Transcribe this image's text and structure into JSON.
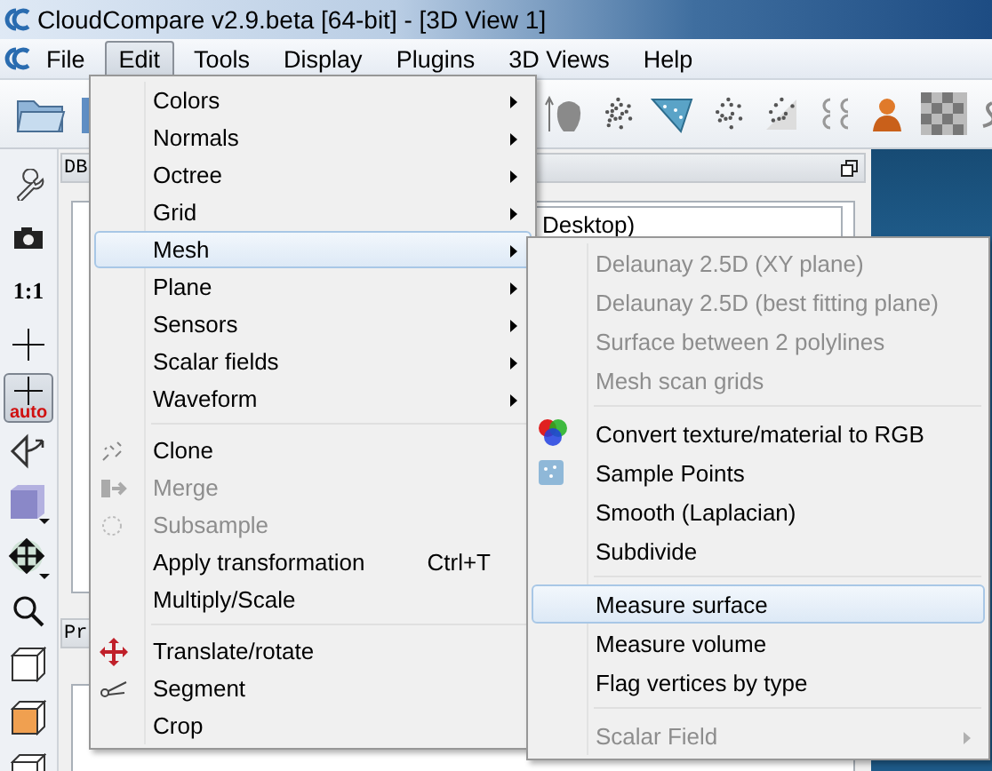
{
  "window": {
    "title": "CloudCompare v2.9.beta [64-bit] - [3D View 1]"
  },
  "menubar": [
    {
      "label": "File",
      "selected": false
    },
    {
      "label": "Edit",
      "selected": true
    },
    {
      "label": "Tools",
      "selected": false
    },
    {
      "label": "Display",
      "selected": false
    },
    {
      "label": "Plugins",
      "selected": false
    },
    {
      "label": "3D Views",
      "selected": false
    },
    {
      "label": "Help",
      "selected": false
    }
  ],
  "left_toolbar": {
    "scale_label": "1:1",
    "auto_label": "auto",
    "auto_pressed": true
  },
  "db_panel": {
    "title": "DB",
    "path": "Desktop)"
  },
  "properties_panel": {
    "title": "Pr"
  },
  "edit_menu": {
    "items": [
      {
        "kind": "submenu",
        "label": "Colors",
        "highlighted": false,
        "disabled": false
      },
      {
        "kind": "submenu",
        "label": "Normals",
        "highlighted": false,
        "disabled": false
      },
      {
        "kind": "submenu",
        "label": "Octree",
        "highlighted": false,
        "disabled": false
      },
      {
        "kind": "submenu",
        "label": "Grid",
        "highlighted": false,
        "disabled": false
      },
      {
        "kind": "submenu",
        "label": "Mesh",
        "highlighted": true,
        "disabled": false
      },
      {
        "kind": "submenu",
        "label": "Plane",
        "highlighted": false,
        "disabled": false
      },
      {
        "kind": "submenu",
        "label": "Sensors",
        "highlighted": false,
        "disabled": false
      },
      {
        "kind": "submenu",
        "label": "Scalar fields",
        "highlighted": false,
        "disabled": false
      },
      {
        "kind": "submenu",
        "label": "Waveform",
        "highlighted": false,
        "disabled": false
      },
      {
        "kind": "separator"
      },
      {
        "kind": "item",
        "label": "Clone",
        "highlighted": false,
        "disabled": false
      },
      {
        "kind": "item",
        "label": "Merge",
        "highlighted": false,
        "disabled": true
      },
      {
        "kind": "item",
        "label": "Subsample",
        "highlighted": false,
        "disabled": true
      },
      {
        "kind": "item",
        "label": "Apply transformation",
        "shortcut": "Ctrl+T",
        "highlighted": false,
        "disabled": false
      },
      {
        "kind": "item",
        "label": "Multiply/Scale",
        "highlighted": false,
        "disabled": false
      },
      {
        "kind": "separator"
      },
      {
        "kind": "item",
        "label": "Translate/rotate",
        "highlighted": false,
        "disabled": false
      },
      {
        "kind": "item",
        "label": "Segment",
        "highlighted": false,
        "disabled": false
      },
      {
        "kind": "item",
        "label": "Crop",
        "highlighted": false,
        "disabled": false
      }
    ]
  },
  "mesh_submenu": {
    "items": [
      {
        "kind": "item",
        "label": "Delaunay 2.5D (XY plane)",
        "highlighted": false,
        "disabled": true
      },
      {
        "kind": "item",
        "label": "Delaunay 2.5D (best fitting plane)",
        "highlighted": false,
        "disabled": true
      },
      {
        "kind": "item",
        "label": "Surface between 2 polylines",
        "highlighted": false,
        "disabled": true
      },
      {
        "kind": "item",
        "label": "Mesh scan grids",
        "highlighted": false,
        "disabled": true
      },
      {
        "kind": "separator"
      },
      {
        "kind": "item",
        "label": "Convert texture/material to RGB",
        "highlighted": false,
        "disabled": false
      },
      {
        "kind": "item",
        "label": "Sample Points",
        "highlighted": false,
        "disabled": false
      },
      {
        "kind": "item",
        "label": "Smooth (Laplacian)",
        "highlighted": false,
        "disabled": false
      },
      {
        "kind": "item",
        "label": "Subdivide",
        "highlighted": false,
        "disabled": false
      },
      {
        "kind": "separator"
      },
      {
        "kind": "item",
        "label": "Measure surface",
        "highlighted": true,
        "disabled": false
      },
      {
        "kind": "item",
        "label": "Measure volume",
        "highlighted": false,
        "disabled": false
      },
      {
        "kind": "item",
        "label": "Flag vertices by type",
        "highlighted": false,
        "disabled": false
      },
      {
        "kind": "separator"
      },
      {
        "kind": "submenu",
        "label": "Scalar Field",
        "highlighted": false,
        "disabled": true
      }
    ]
  }
}
